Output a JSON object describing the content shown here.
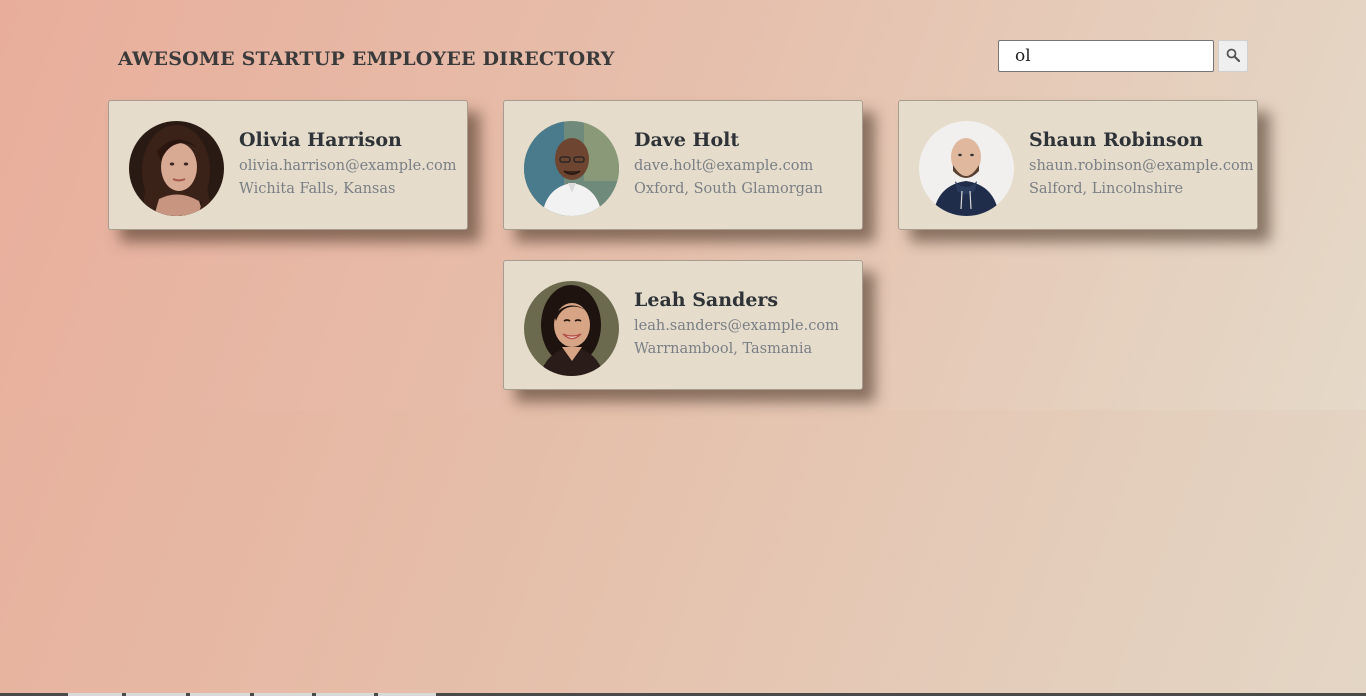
{
  "page": {
    "title": "AWESOME STARTUP EMPLOYEE DIRECTORY"
  },
  "search": {
    "value": "ol",
    "placeholder": "",
    "button_icon": "search-icon"
  },
  "employees": [
    {
      "name": "Olivia Harrison",
      "email": "olivia.harrison@example.com",
      "location": "Wichita Falls, Kansas",
      "avatar": "portrait-woman-dark-hair"
    },
    {
      "name": "Dave Holt",
      "email": "dave.holt@example.com",
      "location": "Oxford, South Glamorgan",
      "avatar": "portrait-man-glasses"
    },
    {
      "name": "Shaun Robinson",
      "email": "shaun.robinson@example.com",
      "location": "Salford, Lincolnshire",
      "avatar": "portrait-man-beard"
    },
    {
      "name": "Leah Sanders",
      "email": "leah.sanders@example.com",
      "location": "Warrnambool, Tasmania",
      "avatar": "portrait-woman-smiling"
    }
  ],
  "colors": {
    "card_background": "#e5dccb",
    "title_text": "#3a3a3a",
    "name_text": "#2f3338",
    "detail_text": "#7a7f85",
    "gradient_start": "#e8ae9b",
    "gradient_end": "#e4d6c5"
  }
}
